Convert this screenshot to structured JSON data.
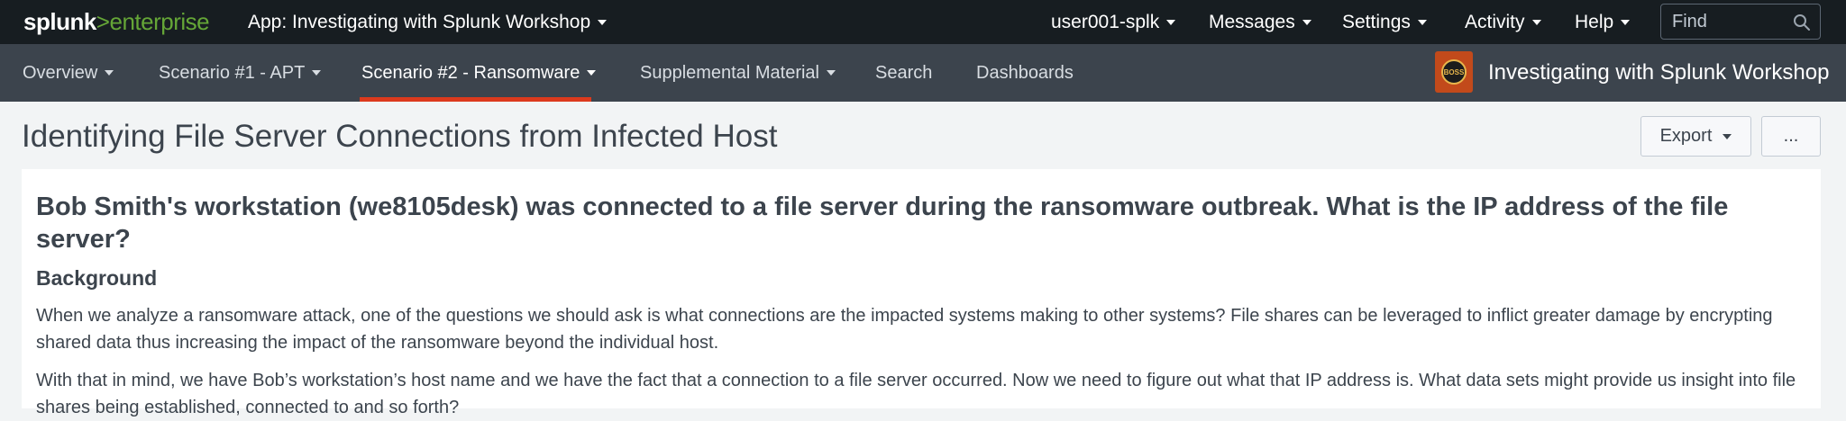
{
  "topbar": {
    "logo_splunk": "splunk",
    "logo_gt": ">",
    "logo_enterprise": "enterprise",
    "app_menu": "App: Investigating with Splunk Workshop",
    "user_menu": "user001-splk",
    "messages_menu": "Messages",
    "settings_menu": "Settings",
    "activity_menu": "Activity",
    "help_menu": "Help",
    "find_placeholder": "Find"
  },
  "appnav": {
    "items": [
      {
        "label": "Overview",
        "has_dropdown": true
      },
      {
        "label": "Scenario #1 - APT",
        "has_dropdown": true
      },
      {
        "label": "Scenario #2 - Ransomware",
        "has_dropdown": true,
        "active": true
      },
      {
        "label": "Supplemental Material",
        "has_dropdown": true
      },
      {
        "label": "Search",
        "has_dropdown": false
      },
      {
        "label": "Dashboards",
        "has_dropdown": false
      }
    ],
    "badge_text": "BOSS",
    "app_title": "Investigating with Splunk Workshop"
  },
  "dashboard": {
    "title": "Identifying File Server Connections from Infected Host",
    "export_label": "Export",
    "more_label": "..."
  },
  "panel": {
    "heading": "Bob Smith's workstation (we8105desk) was connected to a file server during the ransomware outbreak. What is the IP address of the file server?",
    "subheading": "Background",
    "paragraph1": "When we analyze a ransomware attack, one of the questions we should ask is what connections are the impacted systems making to other systems? File shares can be leveraged to inflict greater damage by encrypting shared data thus increasing the impact of the ransomware beyond the individual host.",
    "paragraph2": "With that in mind, we have Bob’s workstation’s host name and we have the fact that a connection to a file server occurred. Now we need to figure out what that IP address is. What data sets might provide us insight into file shares being established, connected to and so forth?"
  },
  "colors": {
    "topbar_bg": "#171d21",
    "appnav_bg": "#3c444d",
    "accent_green": "#65a637",
    "active_underline": "#dc3a1d",
    "page_bg": "#f2f4f5"
  },
  "icons": {
    "find": "search-icon",
    "dropdown": "chevron-down-icon",
    "app_badge": "boss-badge-icon"
  }
}
